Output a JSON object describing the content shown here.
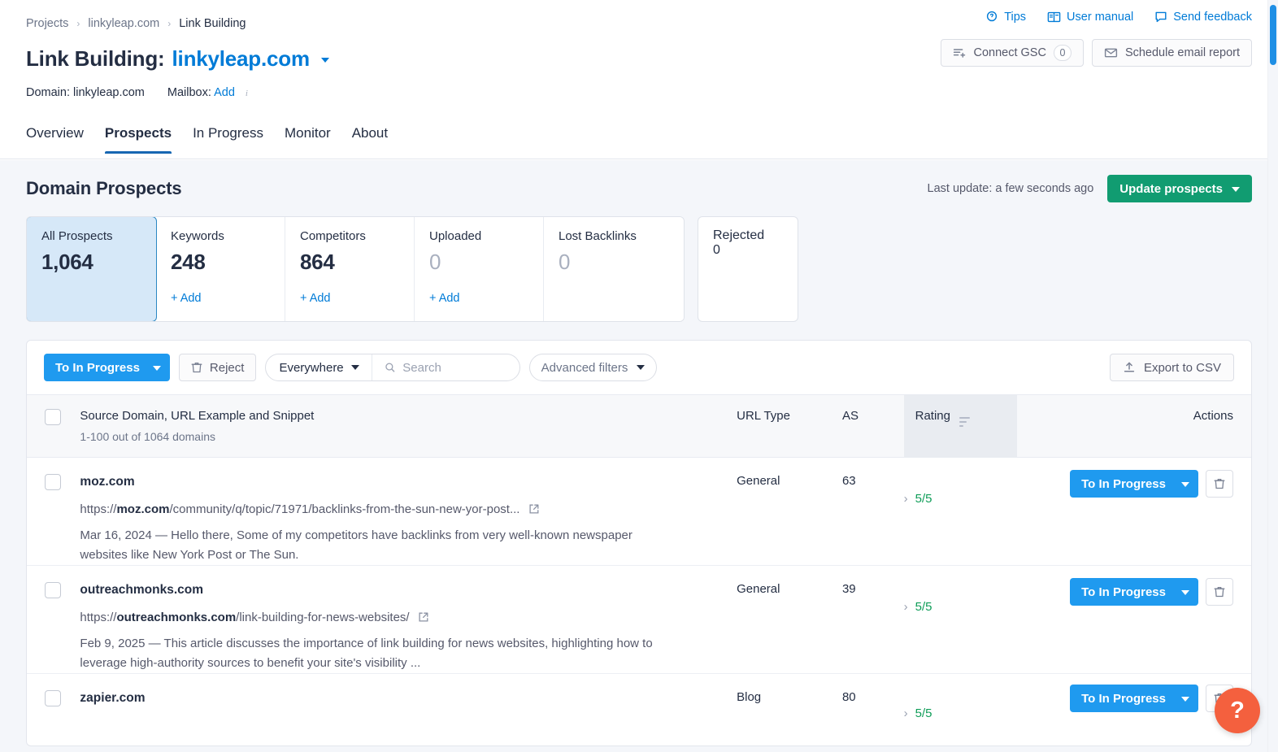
{
  "breadcrumb": {
    "items": [
      {
        "label": "Projects",
        "current": false
      },
      {
        "label": "linkyleap.com",
        "current": false
      },
      {
        "label": "Link Building",
        "current": true
      }
    ],
    "separator": "›"
  },
  "header": {
    "title_prefix": "Link Building:",
    "domain_link": "linkyleap.com",
    "domain_label": "Domain: linkyleap.com",
    "mailbox_label": "Mailbox:",
    "mailbox_add": "Add",
    "links": [
      {
        "label": "Tips",
        "icon": "tips-bulb-icon"
      },
      {
        "label": "User manual",
        "icon": "book-icon"
      },
      {
        "label": "Send feedback",
        "icon": "speech-bubble-icon"
      }
    ],
    "connect_gsc": {
      "label": "Connect GSC",
      "count": "0",
      "icon": "filter-plus-icon"
    },
    "schedule_report": {
      "label": "Schedule email report",
      "icon": "envelope-icon"
    }
  },
  "tabs": [
    {
      "label": "Overview",
      "active": false
    },
    {
      "label": "Prospects",
      "active": true
    },
    {
      "label": "In Progress",
      "active": false
    },
    {
      "label": "Monitor",
      "active": false
    },
    {
      "label": "About",
      "active": false
    }
  ],
  "section": {
    "title": "Domain Prospects",
    "last_update": "Last update: a few seconds ago",
    "update_button": "Update prospects"
  },
  "cards": [
    {
      "label": "All Prospects",
      "value": "1,064",
      "add": null,
      "active": true,
      "zero": false
    },
    {
      "label": "Keywords",
      "value": "248",
      "add": "+ Add",
      "active": false,
      "zero": false
    },
    {
      "label": "Competitors",
      "value": "864",
      "add": "+ Add",
      "active": false,
      "zero": false
    },
    {
      "label": "Uploaded",
      "value": "0",
      "add": "+ Add",
      "active": false,
      "zero": true
    },
    {
      "label": "Lost Backlinks",
      "value": "0",
      "add": null,
      "active": false,
      "zero": true
    }
  ],
  "card_rejected": {
    "label": "Rejected",
    "value": "0",
    "zero": true
  },
  "toolbar": {
    "to_in_progress": "To In Progress",
    "reject": "Reject",
    "scope": "Everywhere",
    "search_value": "",
    "search_placeholder": "Search",
    "advanced_filters": "Advanced filters",
    "export_csv": "Export to CSV"
  },
  "table": {
    "headers": {
      "main": "Source Domain, URL Example and Snippet",
      "main_sub": "1-100 out of 1064 domains",
      "url_type": "URL Type",
      "as": "AS",
      "rating": "Rating",
      "actions": "Actions"
    },
    "rows": [
      {
        "domain": "moz.com",
        "url_bold": "moz.com",
        "url_prefix": "https://",
        "url_rest": "/community/q/topic/71971/backlinks-from-the-sun-new-yor-post...",
        "snippet": "Mar 16, 2024 — Hello there, Some of my competitors have backlinks from very well-known newspaper websites like New York Post or The Sun.",
        "url_type": "General",
        "as": "63",
        "rating": "5/5",
        "action_label": "To In Progress"
      },
      {
        "domain": "outreachmonks.com",
        "url_bold": "outreachmonks.com",
        "url_prefix": "https://",
        "url_rest": "/link-building-for-news-websites/",
        "snippet": "Feb 9, 2025 — This article discusses the importance of link building for news websites, highlighting how to leverage high-authority sources to benefit your site's visibility ...",
        "url_type": "General",
        "as": "39",
        "rating": "5/5",
        "action_label": "To In Progress"
      },
      {
        "domain": "zapier.com",
        "url_bold": "",
        "url_prefix": "",
        "url_rest": "",
        "snippet": "",
        "url_type": "Blog",
        "as": "80",
        "rating": "5/5",
        "action_label": "To In Progress"
      }
    ]
  },
  "help_fab": {
    "label": "?"
  },
  "colors": {
    "accent_blue": "#007bd7",
    "button_blue": "#1f9aef",
    "green": "#119c71",
    "rating_green": "#0f9d58",
    "fab_orange": "#f4603e",
    "card_active_bg": "#d6e8f8",
    "card_active_border": "#2b87c3",
    "page_bg": "#f4f6fa",
    "tab_underline": "#1767b2"
  }
}
